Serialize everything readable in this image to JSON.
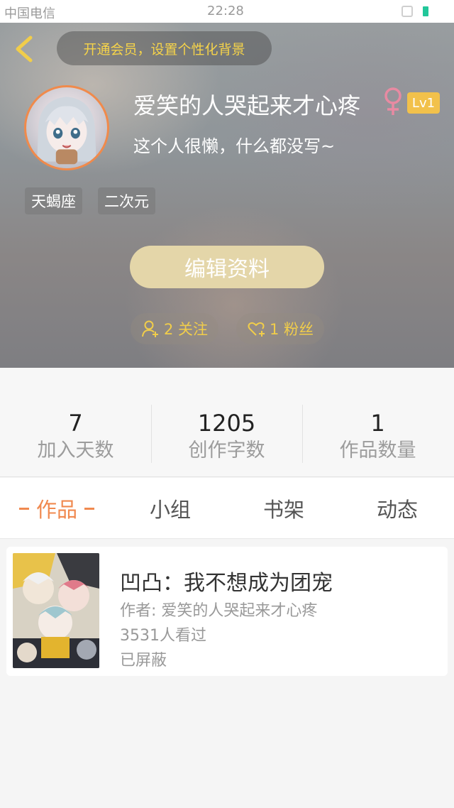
{
  "status_bar": {
    "carrier": "中国电信",
    "time": "22:28"
  },
  "header": {
    "vip_banner": "开通会员，设置个性化背景",
    "back_icon": "chevron-left-icon"
  },
  "profile": {
    "username": "爱笑的人哭起来才心疼",
    "gender_icon": "female-icon",
    "level": "Lv1",
    "bio": "这个人很懒，什么都没写~",
    "tags": [
      "天蝎座",
      "二次元"
    ],
    "edit_button": "编辑资料",
    "following": "2 关注",
    "fans": "1 粉丝"
  },
  "stats": [
    {
      "value": "7",
      "label": "加入天数"
    },
    {
      "value": "1205",
      "label": "创作字数"
    },
    {
      "value": "1",
      "label": "作品数量"
    }
  ],
  "tabs": [
    {
      "label": "作品",
      "active": true
    },
    {
      "label": "小组",
      "active": false
    },
    {
      "label": "书架",
      "active": false
    },
    {
      "label": "动态",
      "active": false
    }
  ],
  "works": [
    {
      "title": "凹凸：我不想成为团宠",
      "author": "作者: 爱笑的人哭起来才心疼",
      "views": "3531人看过",
      "status": "已屏蔽"
    }
  ],
  "colors": {
    "accent": "#f0894f",
    "gold": "#f1cd4a",
    "level_badge": "#f2c14b",
    "edit_button": "#e4d6a9"
  }
}
